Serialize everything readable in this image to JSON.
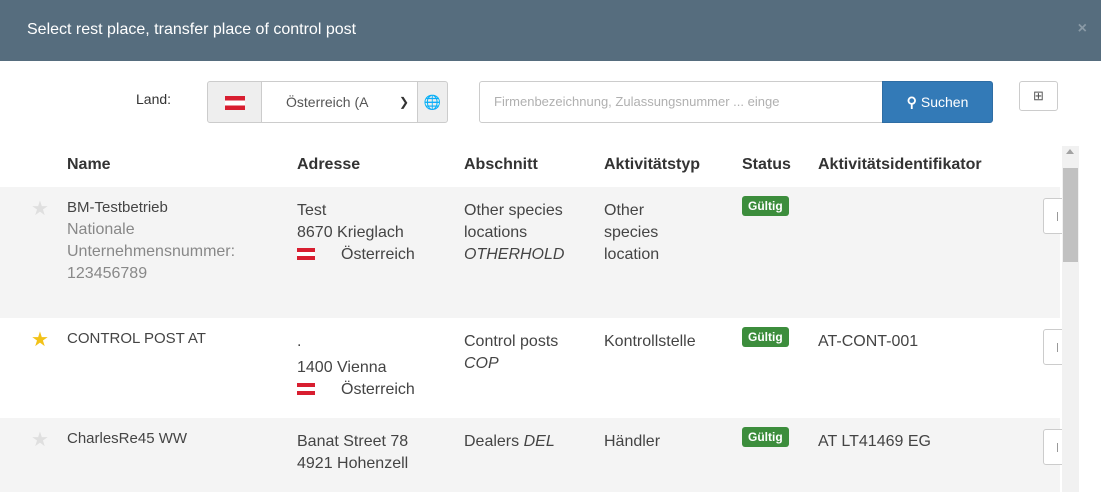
{
  "dialog": {
    "title": "Select rest place, transfer place of control post",
    "close_label": "×"
  },
  "search": {
    "land_label": "Land:",
    "country_value": "Österreich (A",
    "placeholder": "Firmenbezeichnung, Zulassungsnummer ... einge",
    "search_button": "Suchen",
    "icons": {
      "flag": "austria-flag-icon",
      "chevron": "chevron-down-icon",
      "globe": "globe-icon",
      "search": "search-icon",
      "expand": "expand-icon"
    }
  },
  "table": {
    "headers": {
      "name": "Name",
      "address": "Adresse",
      "section": "Abschnitt",
      "activity_type": "Aktivitätstyp",
      "status": "Status",
      "activity_id": "Aktivitätsidentifikator"
    },
    "rows": [
      {
        "favorite": false,
        "name": "BM-Testbetrieb",
        "national_id_label": "Nationale Unternehmensnummer:",
        "national_id_label_1": "Nationale",
        "national_id_label_2": "Unternehmensnummer:",
        "national_id": "123456789",
        "address_line1": "Test",
        "address_line2": "8670 Krieglach",
        "country": "Österreich",
        "section_name": "Other species locations",
        "section_name_1": "Other species",
        "section_name_2": "locations",
        "section_code": "OTHERHOLD",
        "activity_type": "Other species location",
        "activity_type_1": "Other",
        "activity_type_2": "species",
        "activity_type_3": "location",
        "status": "Gültig",
        "activity_id": ""
      },
      {
        "favorite": true,
        "name": "CONTROL POST AT",
        "address_line1": ".",
        "address_line2": "1400 Vienna",
        "country": "Österreich",
        "section_name": "Control posts",
        "section_code": "COP",
        "activity_type": "Kontrollstelle",
        "status": "Gültig",
        "activity_id": "AT-CONT-001"
      },
      {
        "favorite": false,
        "name": "CharlesRe45 WW",
        "address_line1": "Banat Street 78",
        "address_line2": "4921 Hohenzell",
        "section_name": "Dealers",
        "section_code": "DEL",
        "activity_type": "Händler",
        "status": "Gültig",
        "activity_id": "AT LT41469 EG"
      }
    ]
  },
  "colors": {
    "titlebar": "#566d7e",
    "primary_button": "#337ab7",
    "status_valid": "#3c8d3c",
    "star_favorite": "#f2c218",
    "row_alt": "#f4f4f4"
  }
}
